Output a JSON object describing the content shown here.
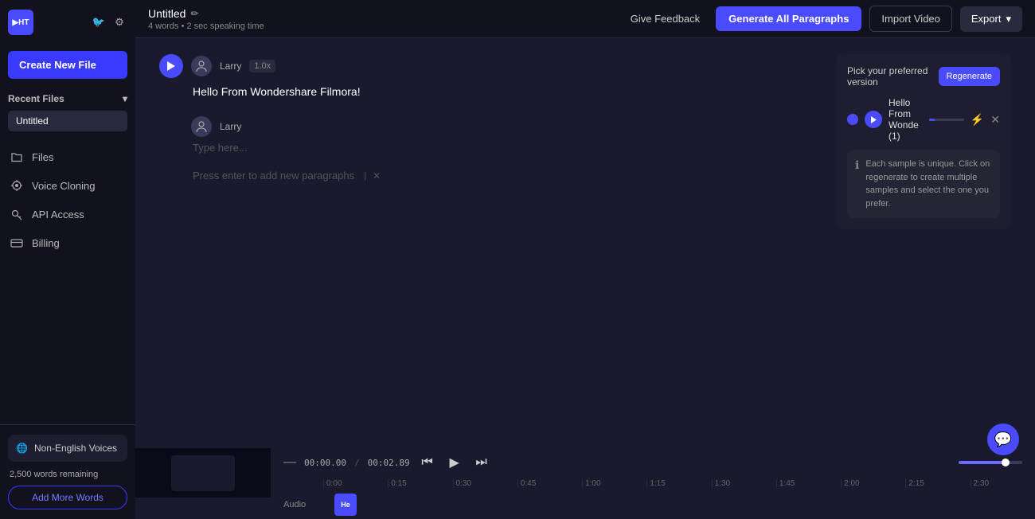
{
  "sidebar": {
    "logo": "PH",
    "create_new_label": "Create New File",
    "recent_files_label": "Recent Files",
    "recent_file_name": "Untitled",
    "nav_items": [
      {
        "id": "files",
        "label": "Files",
        "icon": "folder"
      },
      {
        "id": "voice-cloning",
        "label": "Voice Cloning",
        "icon": "star"
      },
      {
        "id": "api-access",
        "label": "API Access",
        "icon": "key"
      },
      {
        "id": "billing",
        "label": "Billing",
        "icon": "card"
      }
    ],
    "non_english_label": "Non-English Voices",
    "words_remaining": "2,500 words remaining",
    "add_words_label": "Add More Words"
  },
  "topbar": {
    "file_title": "Untitled",
    "file_meta": "4 words • 2 sec speaking time",
    "feedback_label": "Give Feedback",
    "generate_label": "Generate All Paragraphs",
    "import_label": "Import Video",
    "export_label": "Export",
    "chevron": "▾"
  },
  "editor": {
    "paragraph1": {
      "voice": "Larry",
      "speed": "1.0x",
      "text": "Hello From Wondershare Filmora!"
    },
    "paragraph2": {
      "voice": "Larry",
      "placeholder": "Type here..."
    },
    "add_hint": "Press enter to add new paragraphs"
  },
  "regenerate_panel": {
    "title": "Pick your preferred version",
    "regen_label": "Regenerate",
    "sample_label": "Hello From Wonde (1)",
    "info_text": "Each sample is unique. Click on regenerate to create multiple samples and select the one you prefer."
  },
  "transport": {
    "time_current": "00:00.00",
    "time_slash": "/",
    "time_total": "00:02.89"
  },
  "timeline": {
    "audio_label": "Audio",
    "clip_label": "He",
    "ruler_marks": [
      "0:00",
      "0:15",
      "0:30",
      "0:45",
      "1:00",
      "1:15",
      "1:30",
      "1:45",
      "2:00",
      "2:15",
      "2:30"
    ]
  }
}
